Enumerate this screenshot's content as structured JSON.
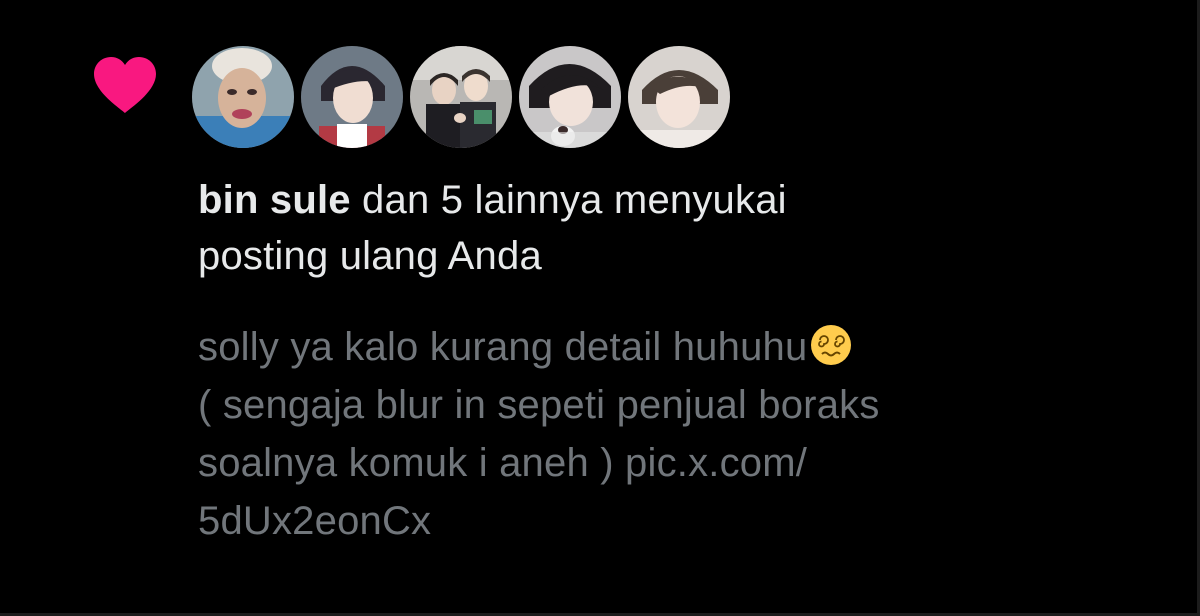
{
  "notification": {
    "type_icon": "heart-icon",
    "heart_color": "#f91880",
    "avatars": [
      {
        "icon": "avatar-1"
      },
      {
        "icon": "avatar-2"
      },
      {
        "icon": "avatar-3"
      },
      {
        "icon": "avatar-4"
      },
      {
        "icon": "avatar-5"
      }
    ],
    "name": "bin sule",
    "rest_line1": " dan 5 lainnya menyukai",
    "line2": "posting ulang Anda",
    "post": {
      "line1": "solly ya kalo kurang detail huhuhu",
      "emoji": "dizzy-face-emoji",
      "line2": "( sengaja blur in sepeti penjual boraks",
      "line3_text": "soalnya komuk i aneh ) ",
      "link_part1": "pic.x.com/",
      "link_part2": "5dUx2eonCx"
    }
  }
}
